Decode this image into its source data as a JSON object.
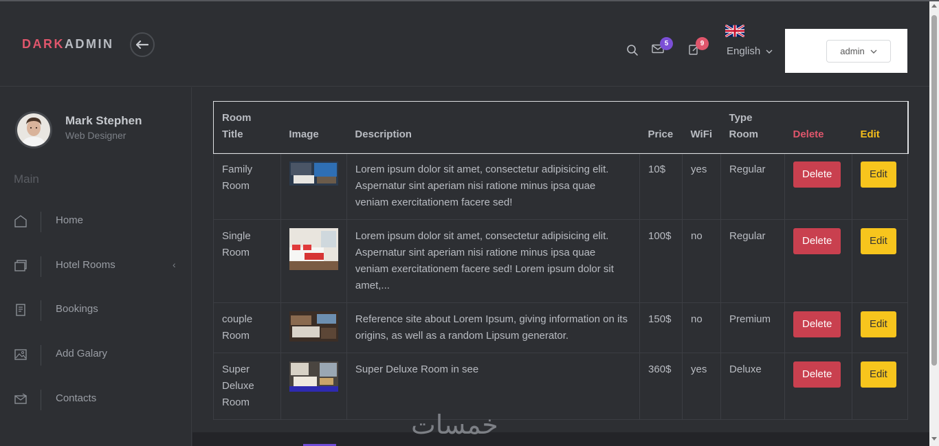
{
  "brand": {
    "part1": "DARK",
    "part2": "ADMIN"
  },
  "header": {
    "messages_count": "5",
    "notifications_count": "9",
    "language": "English",
    "user_menu": "admin"
  },
  "colors": {
    "accent": "#e0566c",
    "delete": "#c9404f",
    "edit": "#f7c51d",
    "badge_messages": "#7b4fd6",
    "badge_notifications": "#e0566c"
  },
  "sidebar": {
    "user_name": "Mark Stephen",
    "user_role": "Web Designer",
    "section": "Main",
    "items": [
      {
        "label": "Home",
        "icon": "home-icon"
      },
      {
        "label": "Hotel Rooms",
        "icon": "rooms-icon"
      },
      {
        "label": "Bookings",
        "icon": "bookings-icon"
      },
      {
        "label": "Add Galary",
        "icon": "gallery-icon"
      },
      {
        "label": "Contacts",
        "icon": "contacts-icon"
      }
    ]
  },
  "table": {
    "headers": {
      "title_line1": "Room",
      "title_line2": "Title",
      "image": "Image",
      "description": "Description",
      "price": "Price",
      "wifi": "WiFi",
      "type_line1": "Type",
      "type_line2": "Room",
      "delete": "Delete",
      "edit": "Edit"
    },
    "rows": [
      {
        "title": "Family Room",
        "description": "Lorem ipsum dolor sit amet, consectetur adipisicing elit. Aspernatur sint aperiam nisi ratione minus ipsa quae veniam exercitationem facere sed!",
        "price": "10$",
        "wifi": "yes",
        "type": "Regular",
        "delete": "Delete",
        "edit": "Edit"
      },
      {
        "title": "Single Room",
        "description": "Lorem ipsum dolor sit amet, consectetur adipisicing elit. Aspernatur sint aperiam nisi ratione minus ipsa quae veniam exercitationem facere sed! Lorem ipsum dolor sit amet,...",
        "price": "100$",
        "wifi": "no",
        "type": "Regular",
        "delete": "Delete",
        "edit": "Edit"
      },
      {
        "title": "couple Room",
        "description": "Reference site about Lorem Ipsum, giving information on its origins, as well as a random Lipsum generator.",
        "price": "150$",
        "wifi": "no",
        "type": "Premium",
        "delete": "Delete",
        "edit": "Edit"
      },
      {
        "title": "Super Deluxe Room",
        "description": "Super Deluxe Room in see",
        "price": "360$",
        "wifi": "yes",
        "type": "Deluxe",
        "delete": "Delete",
        "edit": "Edit"
      }
    ]
  },
  "watermark": "خمسات"
}
